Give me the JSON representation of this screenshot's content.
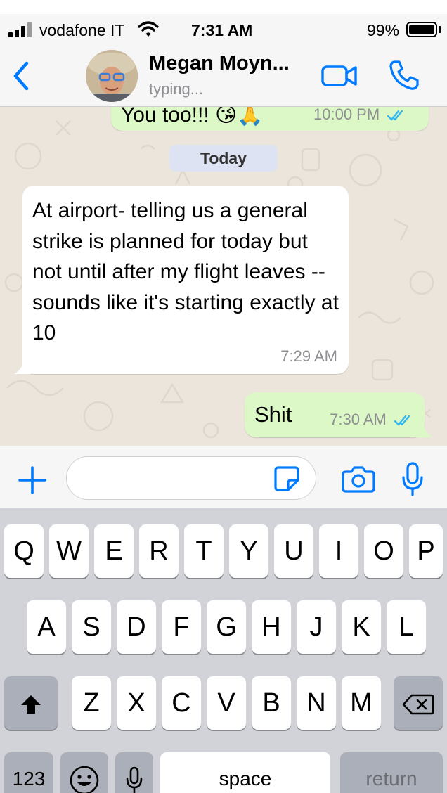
{
  "status_bar": {
    "carrier": "vodafone IT",
    "time": "7:31 AM",
    "battery": "99%"
  },
  "header": {
    "contact_name": "Megan Moyn...",
    "contact_status": "typing..."
  },
  "chat": {
    "messages": [
      {
        "direction": "outgoing",
        "text": "You too!!! 😘🙏",
        "time": "10:00 PM",
        "read": true
      },
      {
        "direction": "incoming",
        "text": "At airport- telling us a general strike is planned for today but not until after my flight leaves -- sounds like it's starting exactly at 10",
        "time": "7:29 AM"
      },
      {
        "direction": "outgoing",
        "text": "Shit",
        "time": "7:30 AM",
        "read": true
      }
    ],
    "day_separator": "Today"
  },
  "input": {
    "placeholder": ""
  },
  "keyboard": {
    "row1": [
      "Q",
      "W",
      "E",
      "R",
      "T",
      "Y",
      "U",
      "I",
      "O",
      "P"
    ],
    "row2": [
      "A",
      "S",
      "D",
      "F",
      "G",
      "H",
      "J",
      "K",
      "L"
    ],
    "row3": [
      "Z",
      "X",
      "C",
      "V",
      "B",
      "N",
      "M"
    ],
    "numbers_key": "123",
    "space_key": "space",
    "return_key": "return"
  },
  "colors": {
    "accent": "#007aff",
    "outgoing_bubble": "#dcf8c6",
    "incoming_bubble": "#ffffff",
    "chat_background": "#ece5dc",
    "read_ticks": "#34b7f1"
  }
}
